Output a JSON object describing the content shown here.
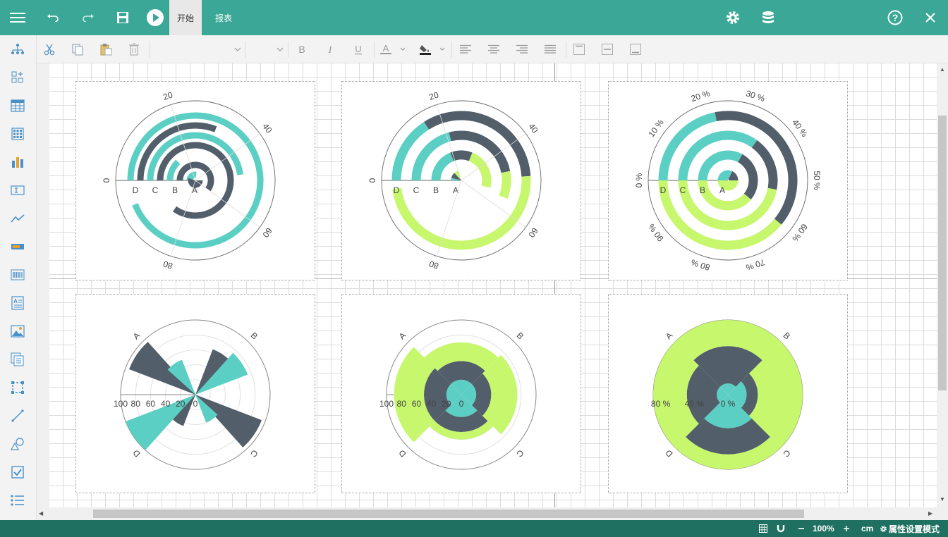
{
  "header": {
    "tabs": [
      {
        "label": "开始",
        "active": true
      },
      {
        "label": "报表",
        "active": false
      }
    ]
  },
  "statusbar": {
    "zoom": "100%",
    "unit": "cm",
    "mode": "属性设置模式"
  },
  "colors": {
    "header": "#3ba897",
    "status": "#1f7060",
    "teal": "#5ccfc4",
    "slate": "#525e69",
    "lime": "#c6f76c"
  },
  "charts": [
    {
      "type": "radial-bar",
      "ticks": [
        "0",
        "20",
        "40",
        "60",
        "80"
      ],
      "categories": [
        "D",
        "C",
        "B",
        "A"
      ],
      "series": [
        {
          "color": "#5ccfc4",
          "values": [
            94,
            48,
            13,
            27
          ]
        },
        {
          "color": "#525e69",
          "values": [
            31,
            85,
            60,
            55
          ]
        }
      ]
    },
    {
      "type": "radial-bar-stacked",
      "ticks": [
        "0",
        "20",
        "40",
        "60",
        "80"
      ],
      "categories": [
        "D",
        "C",
        "B",
        "A"
      ],
      "series": [
        {
          "color": "#5ccfc4",
          "values": [
            16,
            21,
            19,
            4
          ]
        },
        {
          "color": "#525e69",
          "values": [
            33,
            26,
            12,
            9
          ]
        },
        {
          "color": "#c6f76c",
          "values": [
            49,
            9,
            23,
            8
          ]
        }
      ]
    },
    {
      "type": "radial-bar-percent",
      "ticks": [
        "0 %",
        "10 %",
        "20 %",
        "30 %",
        "40 %",
        "50 %",
        "60 %",
        "70 %",
        "80 %",
        "90 %"
      ],
      "categories": [
        "D",
        "C",
        "B",
        "A"
      ],
      "series": [
        {
          "color": "#5ccfc4",
          "values": [
            22,
            35,
            33,
            32
          ]
        },
        {
          "color": "#525e69",
          "values": [
            39,
            18,
            28,
            18
          ]
        },
        {
          "color": "#c6f76c",
          "values": [
            39,
            47,
            39,
            50
          ]
        }
      ]
    },
    {
      "type": "polar-bar",
      "categories": [
        "A",
        "B",
        "C",
        "D"
      ],
      "ticks": [
        "100",
        "80",
        "60",
        "40",
        "20",
        "0"
      ],
      "series": [
        {
          "color": "#525e69",
          "values": [
            95,
            65,
            95,
            45
          ]
        },
        {
          "color": "#5ccfc4",
          "values": [
            50,
            75,
            40,
            100
          ]
        }
      ]
    },
    {
      "type": "polar-bar-stacked",
      "categories": [
        "A",
        "B",
        "C",
        "D"
      ],
      "ticks": [
        "100",
        "80",
        "60",
        "40",
        "20",
        "0"
      ],
      "series": [
        {
          "color": "#5ccfc4",
          "values": [
            20,
            20,
            30,
            20
          ]
        },
        {
          "color": "#525e69",
          "values": [
            25,
            20,
            20,
            30
          ]
        },
        {
          "color": "#c6f76c",
          "values": [
            25,
            35,
            10,
            40
          ]
        }
      ]
    },
    {
      "type": "polar-bar-percent",
      "categories": [
        "A",
        "B",
        "C",
        "D"
      ],
      "ticks": [
        "80 %",
        "40 %",
        "0 %"
      ],
      "series": [
        {
          "color": "#5ccfc4",
          "values": [
            15,
            25,
            45,
            15
          ]
        },
        {
          "color": "#525e69",
          "values": [
            50,
            15,
            35,
            40
          ]
        },
        {
          "color": "#c6f76c",
          "values": [
            35,
            60,
            20,
            45
          ]
        }
      ]
    }
  ]
}
